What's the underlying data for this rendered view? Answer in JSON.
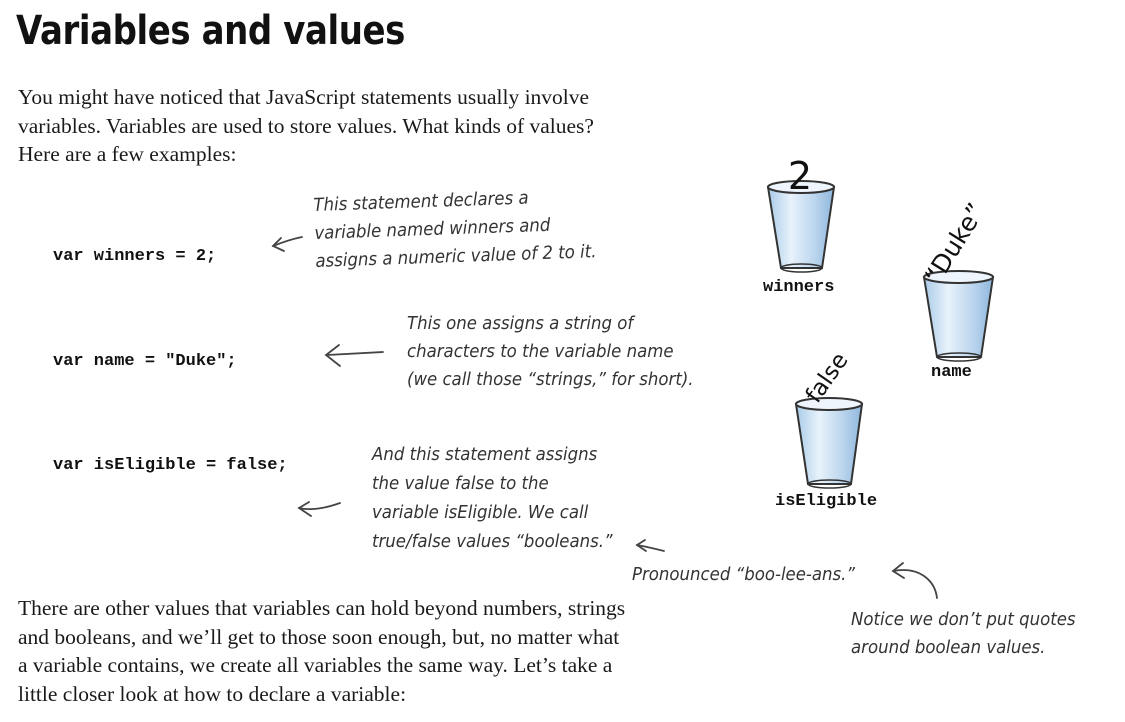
{
  "page": {
    "title": "Variables and values",
    "intro": [
      "You might have noticed that JavaScript statements usually involve",
      "variables. Variables are used to store values. What kinds of values?",
      "Here are a few examples:"
    ],
    "closing": [
      "There are other values that variables can hold beyond numbers, strings",
      "and booleans, and we’ll get to those soon enough, but, no matter what",
      "a variable contains, we create all variables the same way. Let’s take a",
      "little closer look at how to declare a variable:"
    ]
  },
  "code_lines": [
    "var winners = 2;",
    "var name = \"Duke\";",
    "var isEligible = false;"
  ],
  "annotations": {
    "winners_note": [
      "This statement declares a",
      "variable named winners and",
      "assigns a numeric value of 2 to it."
    ],
    "name_note": [
      "This one assigns a string of",
      "characters to the variable name",
      "(we call those “strings,” for short)."
    ],
    "eligible_note": [
      "And this statement assigns",
      "the value false to the",
      "variable isEligible. We call",
      "true/false values “booleans.”"
    ],
    "pronounce_note": "Pronounced “boo-lee-ans.”",
    "quotes_note": [
      "Notice we don’t put quotes",
      "around boolean values."
    ]
  },
  "cups": [
    {
      "value": "2",
      "label": "winners"
    },
    {
      "value": "“Duke”",
      "label": "name"
    },
    {
      "value": "false",
      "label": "isEligible"
    }
  ],
  "colors": {
    "cup_fill": "#cfe3f4",
    "cup_stroke": "#333333"
  }
}
